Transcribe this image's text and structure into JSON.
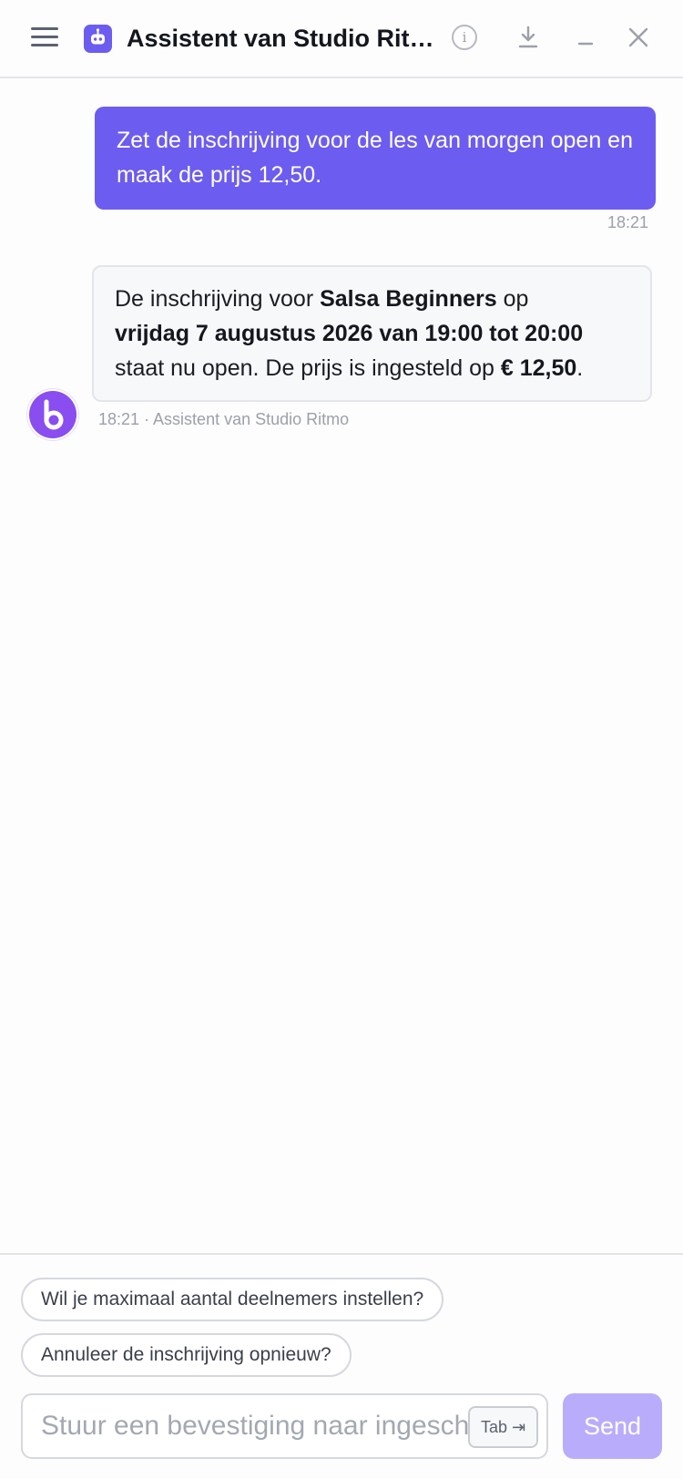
{
  "header": {
    "title": "Assistent van Studio Ritmo",
    "info_glyph": "i",
    "icons": [
      "menu-icon",
      "robot-icon",
      "info-icon",
      "download-icon",
      "minimize-icon",
      "close-icon"
    ]
  },
  "conversation": {
    "user_message": {
      "text": "Zet de inschrijving voor de les van morgen open en maak de prijs 12,50.",
      "time": "18:21"
    },
    "bot_message": {
      "part1": "De inschrijving voor ",
      "class_name": "Salsa Beginners",
      "part2": " op ",
      "datetime": "vrijdag 7 augustus 2026 van 19:00 tot 20:00",
      "part3": " staat nu open. De prijs is ingesteld op ",
      "price": "€ 12,50",
      "part4": ".",
      "meta": "18:21 · Assistent van Studio Ritmo"
    }
  },
  "suggestions": [
    "Wil je maximaal aantal deelnemers instellen?",
    "Annuleer de inschrijving opnieuw?"
  ],
  "composer": {
    "placeholder": "Stuur een bevestiging naar ingeschreven deelnemers",
    "tab_hint": "Tab ⇥",
    "send_label": "Send"
  },
  "colors": {
    "accent": "#6c5cf0",
    "send_disabled": "#b9adfb",
    "avatar": "#8a4df0"
  }
}
